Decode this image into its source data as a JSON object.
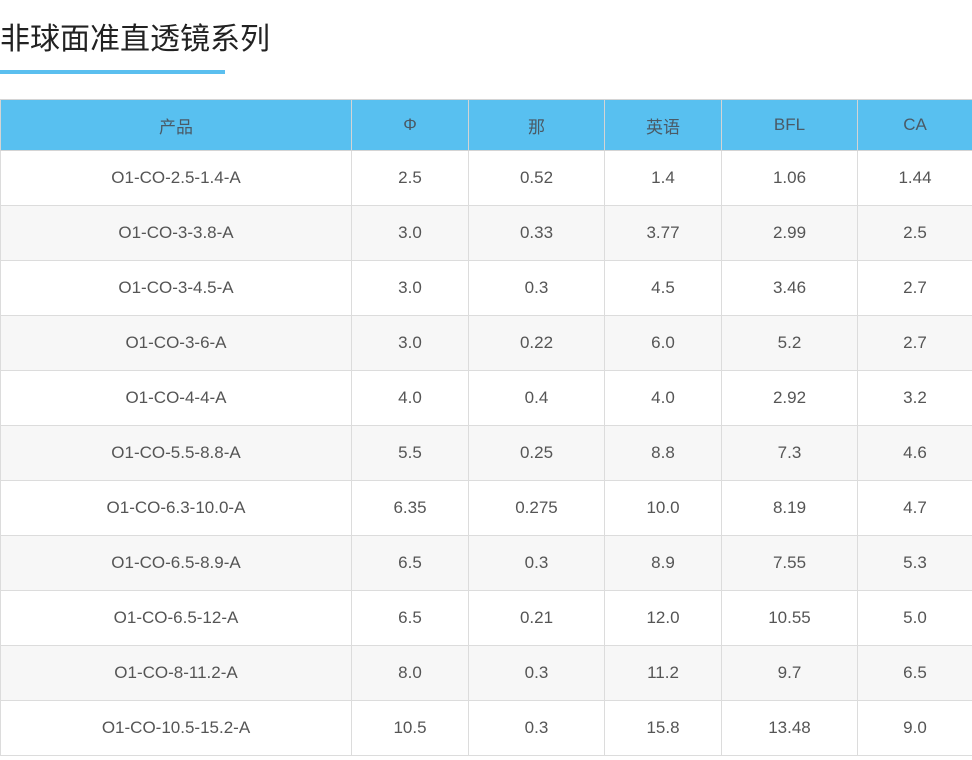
{
  "page": {
    "title": "非球面准直透镜系列"
  },
  "table": {
    "headers": [
      "产品",
      "Φ",
      "那",
      "英语",
      "BFL",
      "CA"
    ],
    "rows": [
      [
        "O1-CO-2.5-1.4-A",
        "2.5",
        "0.52",
        "1.4",
        "1.06",
        "1.44"
      ],
      [
        "O1-CO-3-3.8-A",
        "3.0",
        "0.33",
        "3.77",
        "2.99",
        "2.5"
      ],
      [
        "O1-CO-3-4.5-A",
        "3.0",
        "0.3",
        "4.5",
        "3.46",
        "2.7"
      ],
      [
        "O1-CO-3-6-A",
        "3.0",
        "0.22",
        "6.0",
        "5.2",
        "2.7"
      ],
      [
        "O1-CO-4-4-A",
        "4.0",
        "0.4",
        "4.0",
        "2.92",
        "3.2"
      ],
      [
        "O1-CO-5.5-8.8-A",
        "5.5",
        "0.25",
        "8.8",
        "7.3",
        "4.6"
      ],
      [
        "O1-CO-6.3-10.0-A",
        "6.35",
        "0.275",
        "10.0",
        "8.19",
        "4.7"
      ],
      [
        "O1-CO-6.5-8.9-A",
        "6.5",
        "0.3",
        "8.9",
        "7.55",
        "5.3"
      ],
      [
        "O1-CO-6.5-12-A",
        "6.5",
        "0.21",
        "12.0",
        "10.55",
        "5.0"
      ],
      [
        "O1-CO-8-11.2-A",
        "8.0",
        "0.3",
        "11.2",
        "9.7",
        "6.5"
      ],
      [
        "O1-CO-10.5-15.2-A",
        "10.5",
        "0.3",
        "15.8",
        "13.48",
        "9.0"
      ]
    ]
  },
  "colors": {
    "accent": "#5bbfef",
    "header_bg": "#58c0f0",
    "header_text": "#4a5a66",
    "cell_text": "#555555",
    "stripe": "#f7f7f7"
  }
}
